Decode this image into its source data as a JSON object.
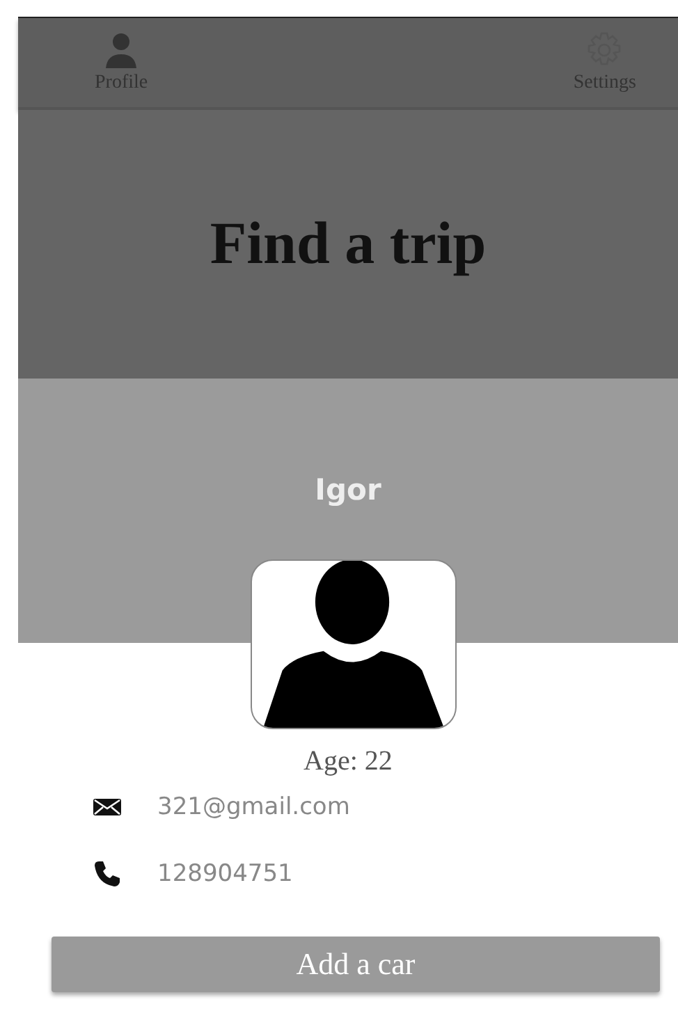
{
  "nav": [
    {
      "kind": "profile",
      "label": "Profile"
    },
    {
      "kind": "settings",
      "label": "Settings"
    }
  ],
  "banner": {
    "title": "Find a trip"
  },
  "profile": {
    "name": "Igor",
    "age": "Age: 22"
  },
  "contacts": [
    {
      "kind": "email",
      "text": "321@gmail.com"
    },
    {
      "kind": "phone",
      "text": "128904751"
    }
  ],
  "button": "Add a car"
}
